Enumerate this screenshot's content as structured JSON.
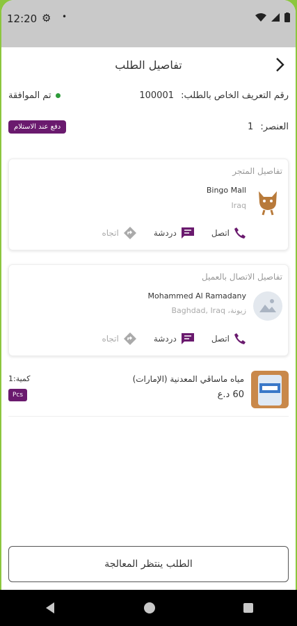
{
  "status_bar": {
    "time": "12:20",
    "settings_icon": "gear-icon",
    "dot": "•"
  },
  "appbar": {
    "title": "تفاصيل الطلب"
  },
  "order": {
    "id_label": "رقم التعريف الخاص بالطلب:",
    "id_value": "100001",
    "status": "تم الموافقة",
    "items_label": "العنصر:",
    "items_count": "1",
    "payment_badge": "دفع عند الاستلام"
  },
  "store_card": {
    "title": "تفاصيل المتجر",
    "name": "Bingo Mall",
    "location": "Iraq",
    "call": "اتصل",
    "chat": "دردشة",
    "direction": "اتجاه"
  },
  "customer_card": {
    "title": "تفاصيل الاتصال بالعميل",
    "name": "Mohammed Al Ramadany",
    "address": "زيونة، Baghdad, Iraq",
    "call": "اتصل",
    "chat": "دردشة",
    "direction": "اتجاه"
  },
  "product": {
    "name": "مياه ماساڤي المعدنية (الإمارات)",
    "price": "60 د.ع",
    "qty": "كمية:1",
    "unit": "Pcs"
  },
  "bottom_button": {
    "label": "الطلب ينتظر المعالجة"
  },
  "colors": {
    "accent": "#6a1a6e",
    "status_green": "#2e9b3a",
    "frame": "#8cc63e"
  }
}
